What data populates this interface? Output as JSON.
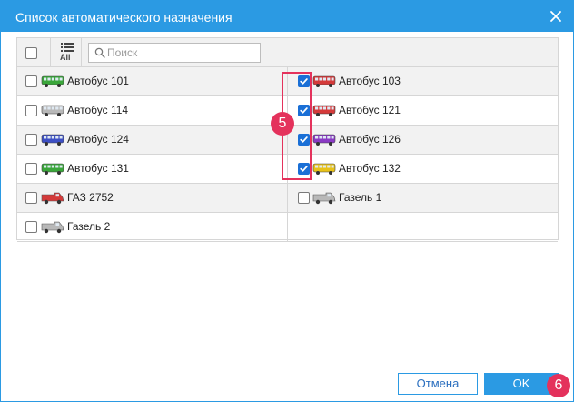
{
  "dialog": {
    "title": "Список автоматического назначения",
    "close_icon": "close-icon"
  },
  "toolbar": {
    "select_all_checked": false,
    "all_label": "All",
    "list_icon": "list-icon",
    "search_icon": "search-icon",
    "search_placeholder": "Поиск",
    "search_value": ""
  },
  "rows": [
    {
      "left": {
        "name": "Автобус 101",
        "checked": false,
        "icon": "bus-icon",
        "color": "#3aa63a"
      },
      "right": {
        "name": "Автобус 103",
        "checked": true,
        "icon": "bus-icon",
        "color": "#d43a3a"
      }
    },
    {
      "left": {
        "name": "Автобус 114",
        "checked": false,
        "icon": "bus-icon",
        "color": "#b8b8b8"
      },
      "right": {
        "name": "Автобус 121",
        "checked": true,
        "icon": "bus-icon",
        "color": "#d43a3a"
      }
    },
    {
      "left": {
        "name": "Автобус 124",
        "checked": false,
        "icon": "bus-icon",
        "color": "#3d4fc4"
      },
      "right": {
        "name": "Автобус 126",
        "checked": true,
        "icon": "bus-icon",
        "color": "#8a3ac4"
      }
    },
    {
      "left": {
        "name": "Автобус 131",
        "checked": false,
        "icon": "bus-icon",
        "color": "#3aa63a"
      },
      "right": {
        "name": "Автобус 132",
        "checked": true,
        "icon": "bus-icon",
        "color": "#e8c21a"
      }
    },
    {
      "left": {
        "name": "ГАЗ 2752",
        "checked": false,
        "icon": "van-icon",
        "color": "#d43a3a"
      },
      "right": {
        "name": "Газель 1",
        "checked": false,
        "icon": "van-icon",
        "color": "#b8b8b8"
      }
    },
    {
      "left": {
        "name": "Газель 2",
        "checked": false,
        "icon": "van-icon",
        "color": "#b8b8b8"
      },
      "right": null
    }
  ],
  "annotations": {
    "badge_5": "5",
    "badge_6": "6",
    "accent": "#e4325c"
  },
  "buttons": {
    "cancel_label": "Отмена",
    "ok_label": "OK"
  },
  "colors": {
    "primary": "#2b9ae3",
    "checkbox_checked": "#1a6fd6"
  }
}
